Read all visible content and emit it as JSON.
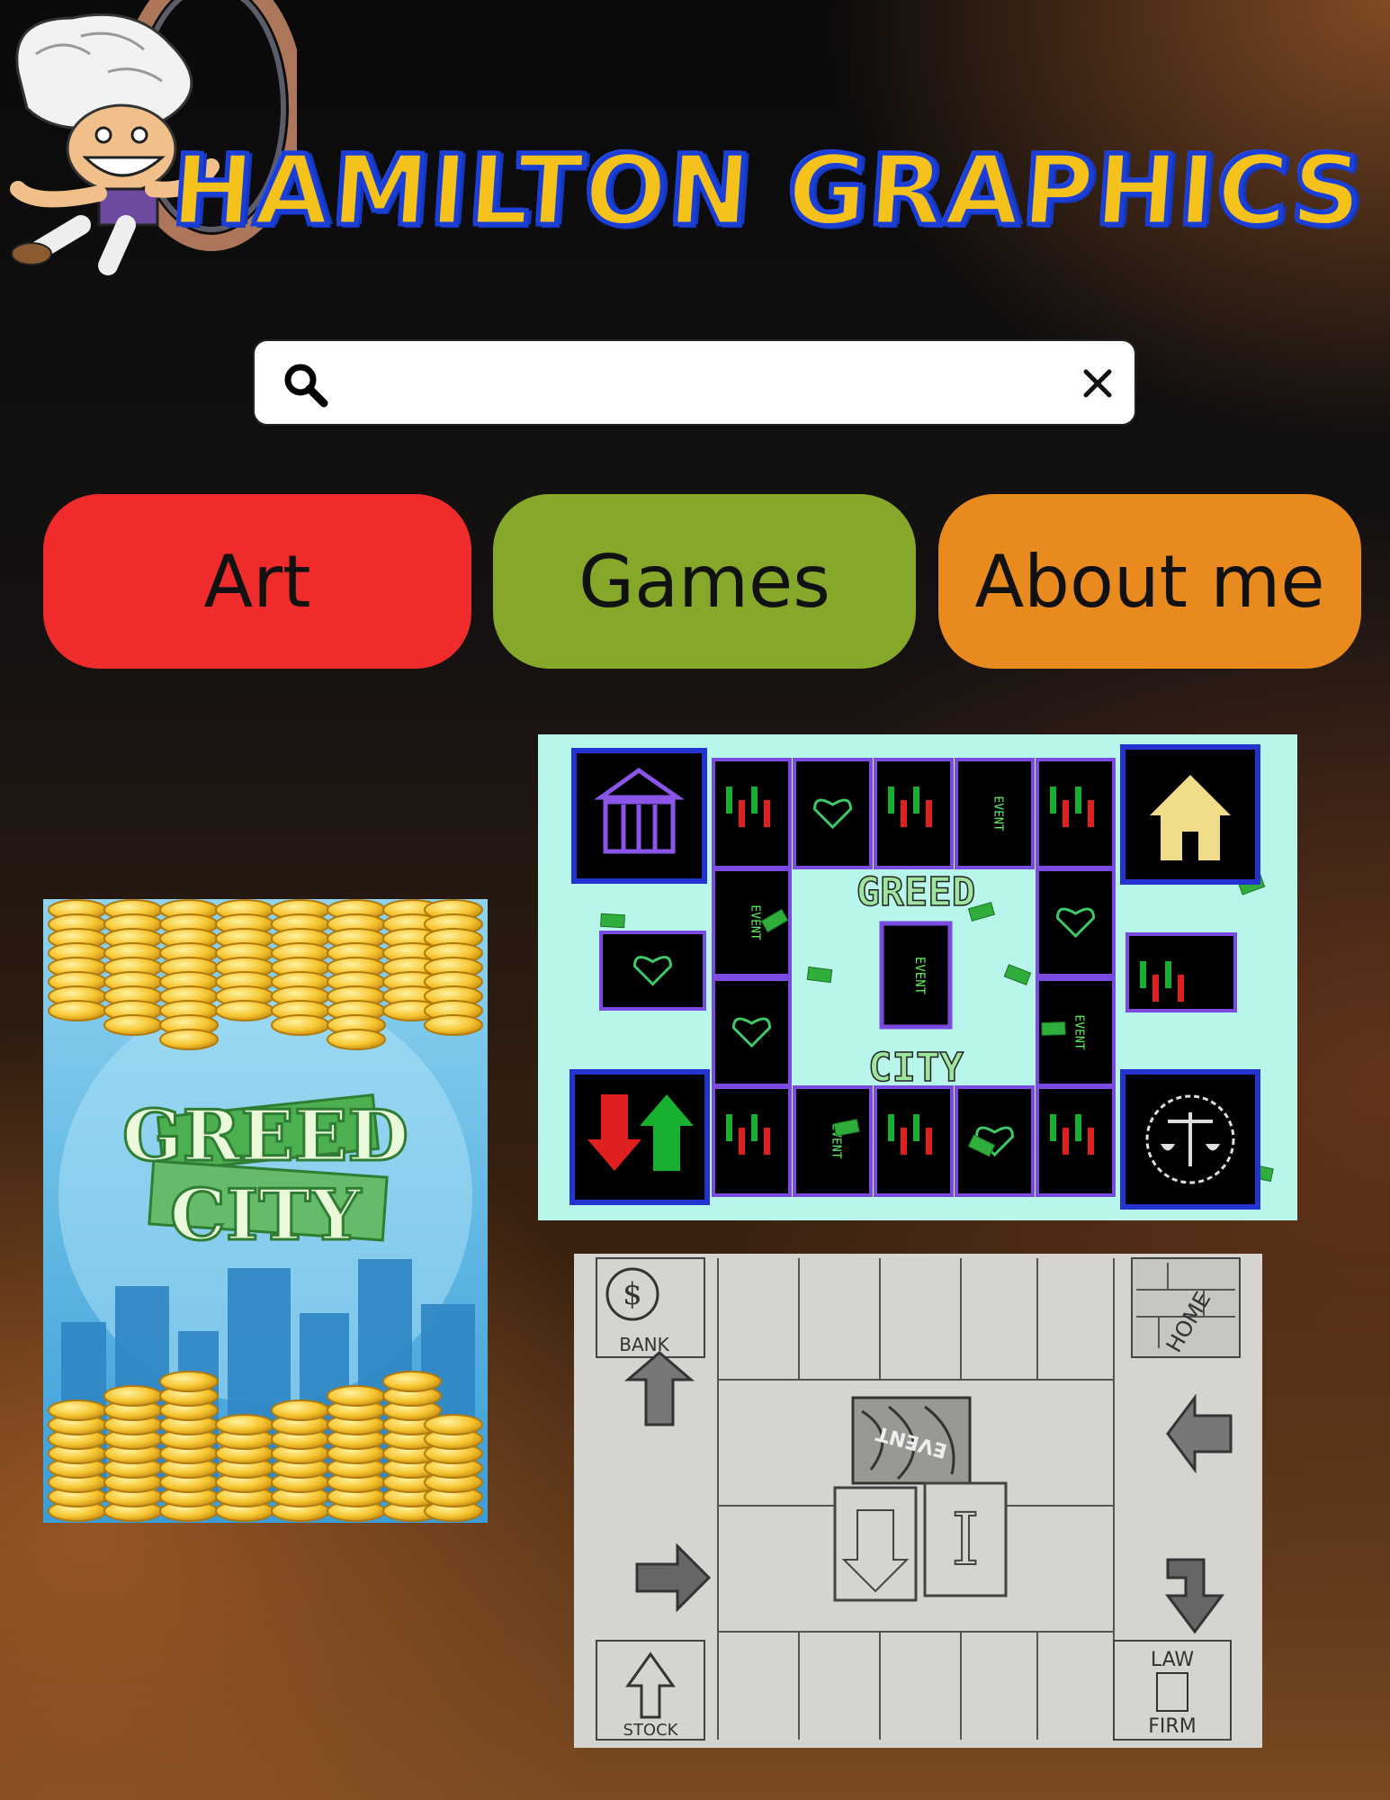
{
  "header": {
    "title": "HAMILTON GRAPHICS",
    "mascot_icon": "cartoon-character-icon"
  },
  "search": {
    "value": "",
    "placeholder": "",
    "search_icon": "search-icon",
    "clear_icon": "close-icon"
  },
  "nav": {
    "items": [
      {
        "label": "Art",
        "color": "#f02b2b"
      },
      {
        "label": "Games",
        "color": "#85a82a"
      },
      {
        "label": "About me",
        "color": "#e88a1e"
      }
    ]
  },
  "gallery": {
    "poster": {
      "line1": "GREED",
      "line2": "CITY"
    },
    "digital_board": {
      "center_top": "GREED",
      "center_bottom": "CITY",
      "event": "EVENT",
      "stock": "STOCK",
      "insurance": "INSURANCE"
    },
    "sketch_board": {
      "bank": "BANK",
      "home": "HOME",
      "event": "EVENT",
      "stock": "STOCK",
      "law": "LAW",
      "firm": "FIRM"
    }
  },
  "colors": {
    "title_fill": "#f5c21b",
    "title_stroke": "#1b3fd6",
    "gold": "#f7c530",
    "board_bg": "#b8f5ea",
    "money_green": "#2fae3c"
  }
}
